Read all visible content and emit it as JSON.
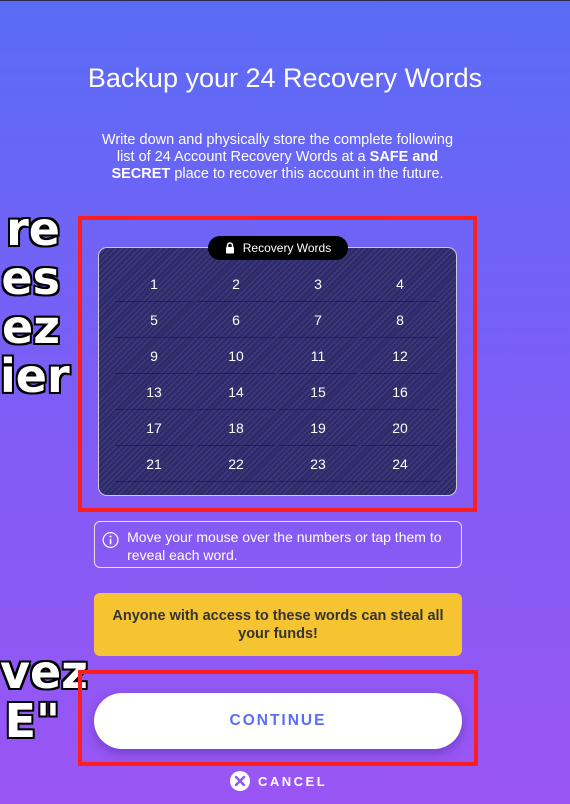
{
  "overlay_text_top": [
    "re",
    "es",
    "ez",
    "ier"
  ],
  "overlay_text_bottom": [
    "vez",
    "E\""
  ],
  "title": "Backup your 24 Recovery Words",
  "description": {
    "line_a": "Write down and physically store the complete following list of 24 Account Recovery Words at a ",
    "bold": "SAFE and SECRET",
    "line_b": " place to recover this account in the future."
  },
  "recovery_panel": {
    "label": "Recovery Words",
    "lock_icon": "lock-icon",
    "numbers": [
      "1",
      "2",
      "3",
      "4",
      "5",
      "6",
      "7",
      "8",
      "9",
      "10",
      "11",
      "12",
      "13",
      "14",
      "15",
      "16",
      "17",
      "18",
      "19",
      "20",
      "21",
      "22",
      "23",
      "24"
    ]
  },
  "info": {
    "icon": "info-icon",
    "text": "Move your mouse over the numbers or tap them to reveal each word."
  },
  "warning": {
    "text": "Anyone with access to these words can steal all your funds!"
  },
  "buttons": {
    "continue_label": "CONTINUE",
    "cancel_label": "CANCEL",
    "cancel_icon": "close-circle-icon"
  },
  "colors": {
    "highlight": "#ff1d1d",
    "warning_bg": "#f7c431",
    "continue_text": "#5b6df3",
    "panel_bg": "#2e2a6b"
  }
}
